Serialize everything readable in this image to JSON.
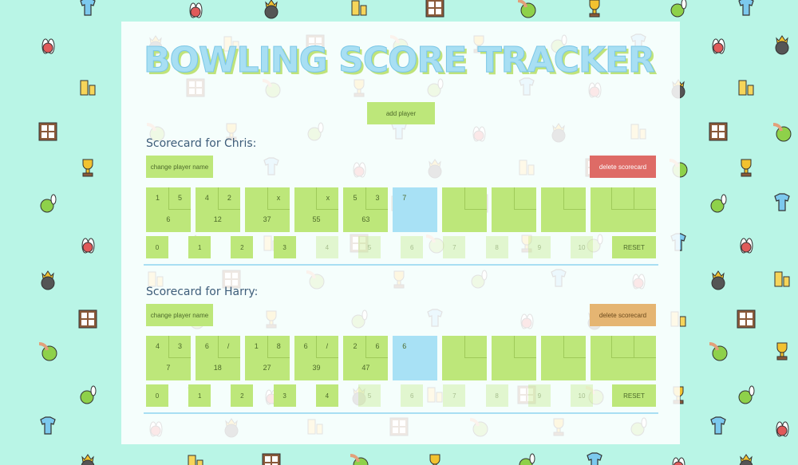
{
  "app": {
    "title": "BOWLING SCORE TRACKER",
    "add_player_label": "add player"
  },
  "colors": {
    "background": "#b9f5e6",
    "green": "#bde77a",
    "blue": "#a8e1f5",
    "red": "#de6b66",
    "orange": "#e5b572"
  },
  "pattern_icons": [
    "polo-shirt-icon",
    "bowling-pins-icon",
    "crowned-bowling-ball-icon",
    "beer-glasses-icon",
    "shoe-shelf-icon",
    "hand-bowling-ball-icon",
    "trophy-icon",
    "bowling-strike-icon"
  ],
  "players": [
    {
      "label": "Scorecard for Chris:",
      "change_label": "change player name",
      "delete_label": "delete scorecard",
      "delete_color": "red",
      "frames": [
        {
          "r1": "1",
          "r2": "5",
          "total": "6"
        },
        {
          "r1": "4",
          "r2": "2",
          "total": "12"
        },
        {
          "r1": "",
          "r2": "x",
          "total": "37"
        },
        {
          "r1": "",
          "r2": "x",
          "total": "55"
        },
        {
          "r1": "5",
          "r2": "3",
          "total": "63"
        },
        {
          "r1": "7",
          "r2": "",
          "total": "",
          "current": true
        },
        {
          "r1": "",
          "r2": "",
          "total": ""
        },
        {
          "r1": "",
          "r2": "",
          "total": ""
        },
        {
          "r1": "",
          "r2": "",
          "total": ""
        },
        {
          "r1": "",
          "r2": "",
          "total": ""
        }
      ],
      "pins": [
        {
          "label": "0",
          "enabled": true
        },
        {
          "label": "1",
          "enabled": true
        },
        {
          "label": "2",
          "enabled": true
        },
        {
          "label": "3",
          "enabled": true
        },
        {
          "label": "4",
          "enabled": false
        },
        {
          "label": "5",
          "enabled": false
        },
        {
          "label": "6",
          "enabled": false
        },
        {
          "label": "7",
          "enabled": false
        },
        {
          "label": "8",
          "enabled": false
        },
        {
          "label": "9",
          "enabled": false
        },
        {
          "label": "10",
          "enabled": false
        }
      ],
      "reset_label": "RESET"
    },
    {
      "label": "Scorecard for Harry:",
      "change_label": "change player name",
      "delete_label": "delete scorecard",
      "delete_color": "orange",
      "frames": [
        {
          "r1": "4",
          "r2": "3",
          "total": "7"
        },
        {
          "r1": "6",
          "r2": "/",
          "total": "18"
        },
        {
          "r1": "1",
          "r2": "8",
          "total": "27"
        },
        {
          "r1": "6",
          "r2": "/",
          "total": "39"
        },
        {
          "r1": "2",
          "r2": "6",
          "total": "47"
        },
        {
          "r1": "6",
          "r2": "",
          "total": "",
          "current": true
        },
        {
          "r1": "",
          "r2": "",
          "total": ""
        },
        {
          "r1": "",
          "r2": "",
          "total": ""
        },
        {
          "r1": "",
          "r2": "",
          "total": ""
        },
        {
          "r1": "",
          "r2": "",
          "total": ""
        }
      ],
      "pins": [
        {
          "label": "0",
          "enabled": true
        },
        {
          "label": "1",
          "enabled": true
        },
        {
          "label": "2",
          "enabled": true
        },
        {
          "label": "3",
          "enabled": true
        },
        {
          "label": "4",
          "enabled": true
        },
        {
          "label": "5",
          "enabled": false
        },
        {
          "label": "6",
          "enabled": false
        },
        {
          "label": "7",
          "enabled": false
        },
        {
          "label": "8",
          "enabled": false
        },
        {
          "label": "9",
          "enabled": false
        },
        {
          "label": "10",
          "enabled": false
        }
      ],
      "reset_label": "RESET"
    }
  ]
}
